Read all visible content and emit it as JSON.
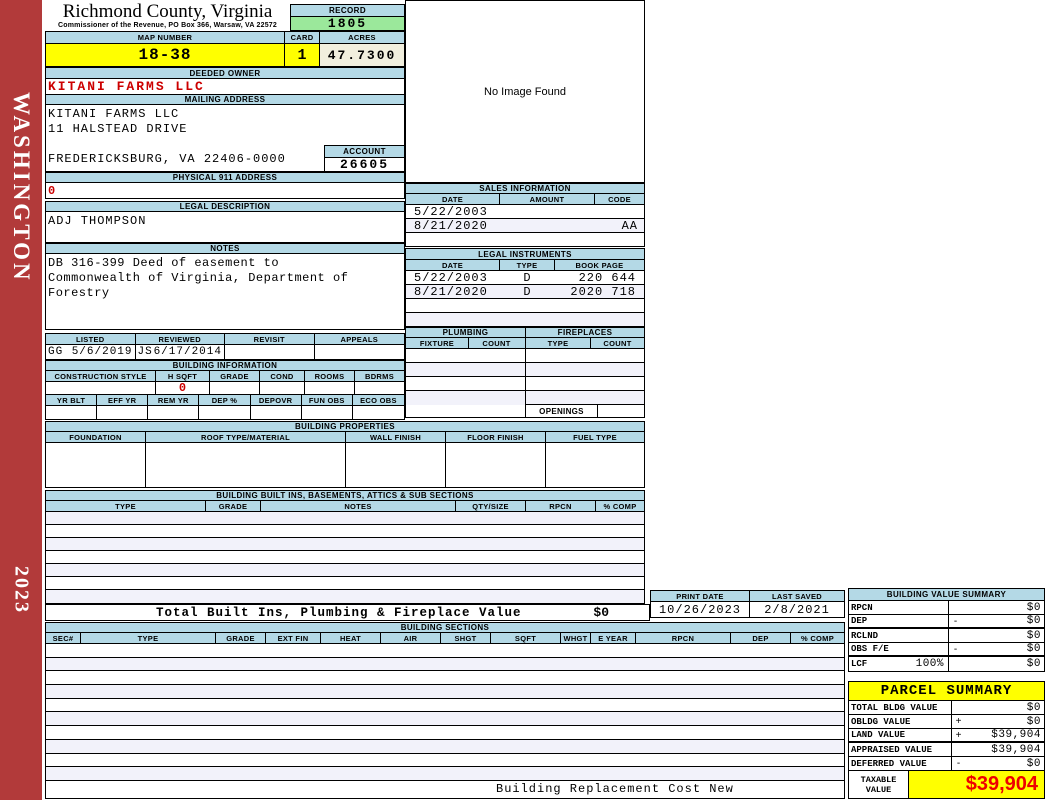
{
  "sidebar": {
    "district": "WASHINGTON",
    "year": "2023"
  },
  "header": {
    "title": "Richmond County, Virginia",
    "subtitle": "Commissioner of the Revenue, PO Box 366, Warsaw, VA 22572",
    "record_label": "RECORD",
    "record_value": "1805",
    "map_label": "MAP NUMBER",
    "map_value": "18-38",
    "card_label": "CARD",
    "card_value": "1",
    "acres_label": "ACRES",
    "acres_value": "47.7300"
  },
  "owner": {
    "deeded_label": "DEEDED OWNER",
    "deeded_value": "KITANI FARMS LLC",
    "mailing_label": "MAILING ADDRESS",
    "mailing_line1": "KITANI FARMS LLC",
    "mailing_line2": "11 HALSTEAD DRIVE",
    "mailing_line3": "FREDERICKSBURG, VA 22406-0000",
    "account_label": "ACCOUNT",
    "account_value": "26605",
    "physical_label": "PHYSICAL 911 ADDRESS",
    "physical_value": "0",
    "legal_label": "LEGAL DESCRIPTION",
    "legal_value": "ADJ THOMPSON",
    "notes_label": "NOTES",
    "notes_value": "DB 316-399 Deed of easement to\nCommonwealth of Virginia, Department of\nForestry"
  },
  "review": {
    "columns": [
      "LISTED",
      "REVIEWED",
      "REVISIT",
      "APPEALS"
    ],
    "listed_by": "GG",
    "listed_date": "5/6/2019",
    "reviewed_by": "JS",
    "reviewed_date": "6/17/2014",
    "revisit": "",
    "appeals": ""
  },
  "building_info": {
    "title": "BUILDING INFORMATION",
    "row1_columns": [
      "CONSTRUCTION STYLE",
      "H SQFT",
      "GRADE",
      "COND",
      "ROOMS",
      "BDRMS"
    ],
    "h_sqft_value": "0",
    "row2_columns": [
      "YR BLT",
      "EFF YR",
      "REM YR",
      "DEP %",
      "DEPOVR",
      "FUN OBS",
      "ECO OBS"
    ]
  },
  "building_properties": {
    "title": "BUILDING PROPERTIES",
    "columns": [
      "FOUNDATION",
      "ROOF TYPE/MATERIAL",
      "WALL FINISH",
      "FLOOR FINISH",
      "FUEL TYPE"
    ]
  },
  "built_ins": {
    "title": "BUILDING BUILT INS, BASEMENTS, ATTICS & SUB SECTIONS",
    "columns": [
      "TYPE",
      "GRADE",
      "NOTES",
      "QTY/SIZE",
      "RPCN",
      "% COMP"
    ],
    "total_label": "Total Built Ins, Plumbing & Fireplace Value",
    "total_value": "$0"
  },
  "image_box": {
    "text": "No Image Found"
  },
  "sales": {
    "title": "SALES INFORMATION",
    "columns": [
      "DATE",
      "AMOUNT",
      "CODE"
    ],
    "rows": [
      {
        "date": "5/22/2003",
        "amount": "",
        "code": ""
      },
      {
        "date": "8/21/2020",
        "amount": "",
        "code": "AA"
      }
    ]
  },
  "instruments": {
    "title": "LEGAL INSTRUMENTS",
    "columns": [
      "DATE",
      "TYPE",
      "BOOK PAGE"
    ],
    "rows": [
      {
        "date": "5/22/2003",
        "type": "D",
        "book_page": "220 644"
      },
      {
        "date": "8/21/2020",
        "type": "D",
        "book_page": "2020 718"
      }
    ]
  },
  "plumbing": {
    "title": "PLUMBING",
    "columns": [
      "FIXTURE",
      "COUNT"
    ]
  },
  "fireplaces": {
    "title": "FIREPLACES",
    "columns": [
      "TYPE",
      "COUNT"
    ],
    "openings_label": "OPENINGS"
  },
  "print_info": {
    "print_label": "PRINT DATE",
    "print_value": "10/26/2023",
    "saved_label": "LAST SAVED",
    "saved_value": "2/8/2021"
  },
  "building_sections": {
    "title": "BUILDING SECTIONS",
    "columns": [
      "SEC#",
      "TYPE",
      "GRADE",
      "EXT FIN",
      "HEAT",
      "AIR",
      "SHGT",
      "SQFT",
      "WHGT",
      "E YEAR",
      "RPCN",
      "DEP",
      "% COMP"
    ],
    "footer": "Building Replacement Cost New"
  },
  "value_summary": {
    "title": "BUILDING VALUE SUMMARY",
    "rows": [
      {
        "label": "RPCN",
        "op": "",
        "value": "$0"
      },
      {
        "label": "DEP",
        "op": "-",
        "value": "$0"
      },
      {
        "label": "RCLND",
        "op": "",
        "value": "$0"
      },
      {
        "label": "OBS F/E",
        "op": "-",
        "value": "$0"
      },
      {
        "label": "LCF",
        "pct": "100%",
        "op": "",
        "value": "$0"
      }
    ]
  },
  "parcel_summary": {
    "title": "PARCEL SUMMARY",
    "rows": [
      {
        "label": "TOTAL BLDG VALUE",
        "op": "",
        "value": "$0"
      },
      {
        "label": "OBLDG VALUE",
        "op": "+",
        "value": "$0"
      },
      {
        "label": "LAND VALUE",
        "op": "+",
        "value": "$39,904"
      },
      {
        "label": "APPRAISED VALUE",
        "op": "",
        "value": "$39,904"
      },
      {
        "label": "DEFERRED VALUE",
        "op": "-",
        "value": "$0"
      }
    ],
    "taxable_label": "TAXABLE VALUE",
    "taxable_value": "$39,904"
  },
  "colors": {
    "header_blue": "#B4D9E6",
    "record_green": "#9BE89B",
    "highlight_yellow": "#FFFF00",
    "acres_ivory": "#F1EFDE",
    "sidebar_red": "#B23A3A",
    "value_red": "#CC0000",
    "taxable_red": "#EE0000",
    "row_alt": "#F2F2FA"
  }
}
